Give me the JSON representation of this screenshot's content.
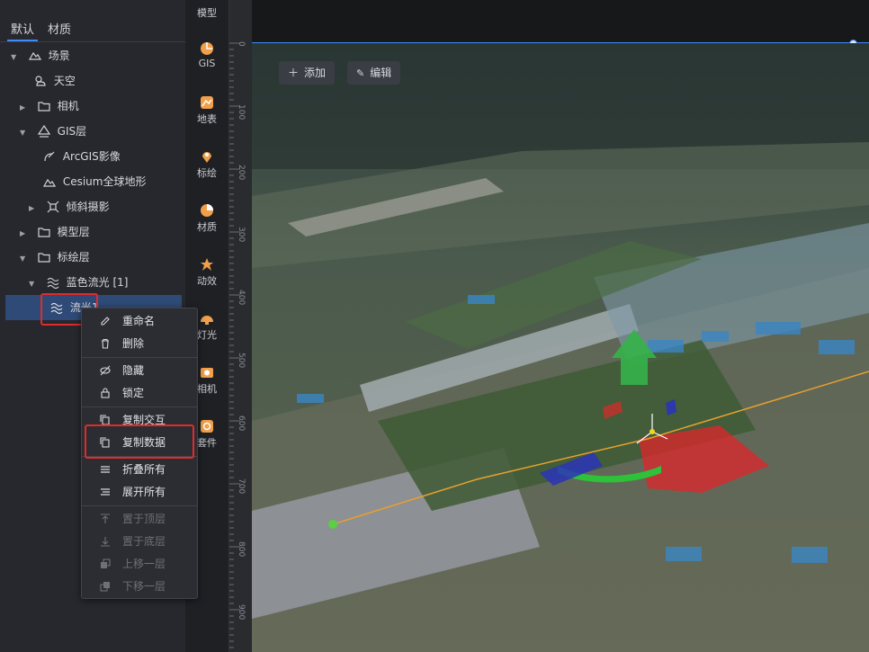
{
  "tabs": [
    "默认",
    "材质"
  ],
  "tree": [
    {
      "label": "场景",
      "icon": "scene-icon",
      "expanded": true
    },
    {
      "label": "天空",
      "icon": "sky-icon"
    },
    {
      "label": "相机",
      "icon": "folder-icon",
      "collapsed": true
    },
    {
      "label": "GIS层",
      "icon": "gis-layer-icon",
      "expanded": true
    },
    {
      "label": "ArcGIS影像",
      "icon": "satellite-icon"
    },
    {
      "label": "Cesium全球地形",
      "icon": "terrain-icon"
    },
    {
      "label": "倾斜摄影",
      "icon": "oblique-icon",
      "collapsed": true
    },
    {
      "label": "模型层",
      "icon": "folder-icon",
      "collapsed": true
    },
    {
      "label": "标绘层",
      "icon": "folder-icon",
      "expanded": true
    },
    {
      "label": "蓝色流光 [1]",
      "icon": "flow-icon",
      "expanded": true
    },
    {
      "label": "流光1",
      "icon": "flow-icon",
      "selected": true
    }
  ],
  "nav": [
    {
      "label": "模型",
      "icon": "model-icon"
    },
    {
      "label": "GIS",
      "icon": "gis-icon"
    },
    {
      "label": "地表",
      "icon": "surface-icon"
    },
    {
      "label": "标绘",
      "icon": "marker-icon"
    },
    {
      "label": "材质",
      "icon": "material-icon"
    },
    {
      "label": "动效",
      "icon": "effect-icon"
    },
    {
      "label": "灯光",
      "icon": "light-icon"
    },
    {
      "label": "相机",
      "icon": "camera-icon"
    },
    {
      "label": "套件",
      "icon": "kit-icon"
    }
  ],
  "ruler_ticks": [
    "0",
    "100",
    "200",
    "300",
    "400",
    "500",
    "600",
    "700",
    "800",
    "900"
  ],
  "toolbar": {
    "add_label": "添加",
    "edit_label": "编辑"
  },
  "context_menu": [
    {
      "label": "重命名",
      "icon": "pencil-icon",
      "enabled": true
    },
    {
      "label": "删除",
      "icon": "trash-icon",
      "enabled": true
    },
    {
      "label": "隐藏",
      "icon": "eye-off-icon",
      "enabled": true
    },
    {
      "label": "锁定",
      "icon": "lock-icon",
      "enabled": true
    },
    {
      "label": "复制交互",
      "icon": "copy-icon",
      "enabled": true
    },
    {
      "label": "复制数据",
      "icon": "copy-icon",
      "enabled": true,
      "highlighted": true
    },
    {
      "label": "折叠所有",
      "icon": "collapse-icon",
      "enabled": true
    },
    {
      "label": "展开所有",
      "icon": "expand-icon",
      "enabled": true
    },
    {
      "label": "置于顶层",
      "icon": "to-top-icon",
      "enabled": false
    },
    {
      "label": "置于底层",
      "icon": "to-bottom-icon",
      "enabled": false
    },
    {
      "label": "上移一层",
      "icon": "move-up-icon",
      "enabled": false
    },
    {
      "label": "下移一层",
      "icon": "move-down-icon",
      "enabled": false
    }
  ],
  "colors": {
    "accent": "#3d8bfd",
    "highlight": "#e02b2b",
    "panel": "#26282d",
    "nav_icon": "#f0a04b"
  }
}
